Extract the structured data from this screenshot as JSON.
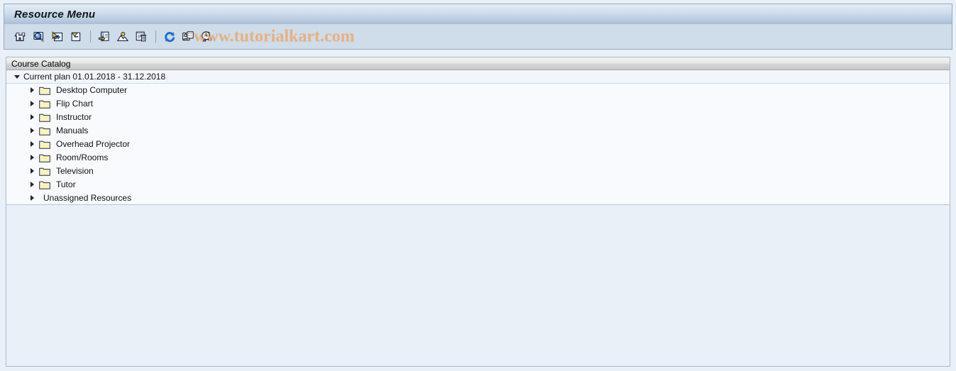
{
  "window": {
    "title": "Resource Menu"
  },
  "toolbar": {
    "groups": [
      {
        "buttons": [
          {
            "icon": "binoculars-find-icon",
            "label": "Find"
          },
          {
            "icon": "magnifier-display-icon",
            "label": "Display"
          },
          {
            "icon": "expand-node-plus-icon",
            "label": "Expand Node"
          },
          {
            "icon": "collapse-node-minus-icon",
            "label": "Collapse Node"
          }
        ]
      },
      {
        "buttons": [
          {
            "icon": "create-document-icon",
            "label": "Create"
          },
          {
            "icon": "picture-graphic-icon",
            "label": "Graphic"
          },
          {
            "icon": "delete-trash-icon",
            "label": "Delete"
          }
        ]
      },
      {
        "buttons": [
          {
            "icon": "refresh-icon",
            "label": "Refresh"
          },
          {
            "icon": "settings-person-icon",
            "label": "Settings"
          },
          {
            "icon": "clock-time-icon",
            "label": "Planning Period"
          }
        ]
      }
    ],
    "watermark": "www.tutorialkart.com",
    "watermark_color": "#e5b183"
  },
  "tree": {
    "header": "Course Catalog",
    "root": {
      "label": "Current plan 01.01.2018 - 31.12.2018",
      "expanded": true,
      "arrow": "chevron-down-icon"
    },
    "children": [
      {
        "label": "Desktop Computer",
        "icon": "folder-icon",
        "arrow": "chevron-right-icon",
        "has_folder": true
      },
      {
        "label": "Flip Chart",
        "icon": "folder-icon",
        "arrow": "chevron-right-icon",
        "has_folder": true
      },
      {
        "label": "Instructor",
        "icon": "folder-icon",
        "arrow": "chevron-right-icon",
        "has_folder": true
      },
      {
        "label": "Manuals",
        "icon": "folder-icon",
        "arrow": "chevron-right-icon",
        "has_folder": true
      },
      {
        "label": "Overhead Projector",
        "icon": "folder-icon",
        "arrow": "chevron-right-icon",
        "has_folder": true
      },
      {
        "label": "Room/Rooms",
        "icon": "folder-icon",
        "arrow": "chevron-right-icon",
        "has_folder": true
      },
      {
        "label": "Television",
        "icon": "folder-icon",
        "arrow": "chevron-right-icon",
        "has_folder": true
      },
      {
        "label": "Tutor",
        "icon": "folder-icon",
        "arrow": "chevron-right-icon",
        "has_folder": true
      },
      {
        "label": "Unassigned Resources",
        "icon": "",
        "arrow": "chevron-right-icon",
        "has_folder": false
      }
    ]
  },
  "colors": {
    "title_bar_top": "#e4ecf5",
    "title_bar_bottom": "#a9bed6",
    "toolbar_bg": "#cfdce9",
    "content_bg": "#eaf0f8",
    "tree_row_bg": "#f2f6fb",
    "folder_fill": "#fcf3ba",
    "folder_stroke": "#1f2d55",
    "panel_border": "#a8b8cc"
  }
}
